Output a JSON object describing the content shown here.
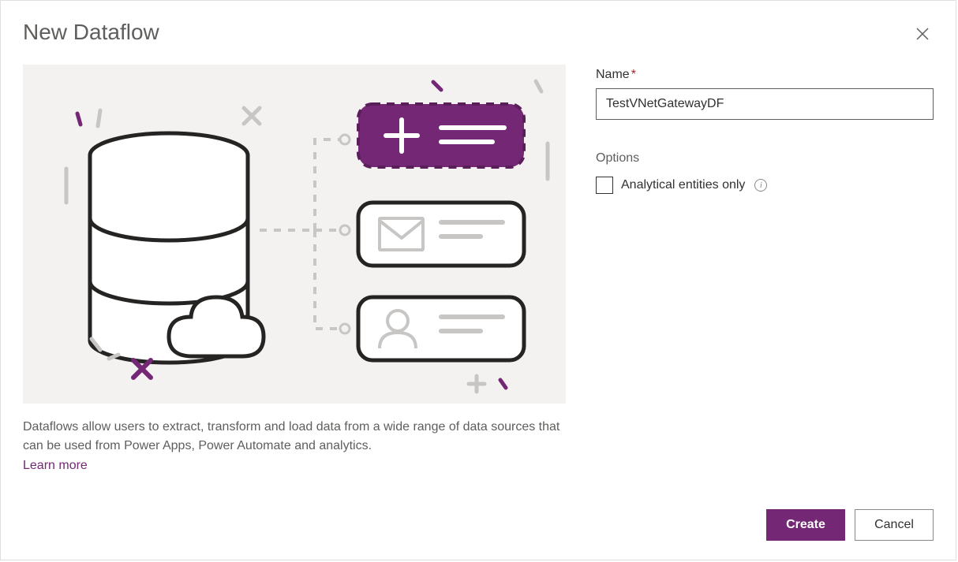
{
  "dialog": {
    "title": "New Dataflow",
    "close_aria": "Close"
  },
  "description": {
    "text": "Dataflows allow users to extract, transform and load data from a wide range of data sources that can be used from Power Apps, Power Automate and analytics.",
    "learn_more": "Learn more"
  },
  "form": {
    "name_label": "Name",
    "name_value": "TestVNetGatewayDF",
    "options_heading": "Options",
    "analytical_label": "Analytical entities only",
    "analytical_checked": false
  },
  "footer": {
    "create": "Create",
    "cancel": "Cancel"
  },
  "colors": {
    "accent": "#742774",
    "panel_bg": "#f3f2f1"
  }
}
